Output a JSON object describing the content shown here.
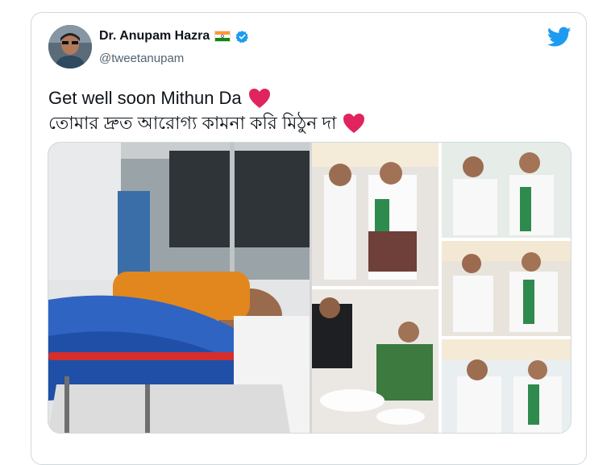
{
  "author": {
    "display_name": "Dr. Anupam Hazra",
    "handle": "@tweetanupam"
  },
  "tweet": {
    "line1": "Get well soon Mithun Da",
    "line2": "তোমার দ্রুত আরোগ্য কামনা করি মিঠুন দা"
  },
  "colors": {
    "twitter_blue": "#1d9bf0",
    "heart_red": "#e0245e",
    "verified_blue": "#1d9bf0"
  },
  "icons": {
    "logo": "twitter-bird-icon",
    "verified": "verified-badge-icon",
    "flag": "india-flag-icon",
    "heart": "red-heart-icon"
  }
}
